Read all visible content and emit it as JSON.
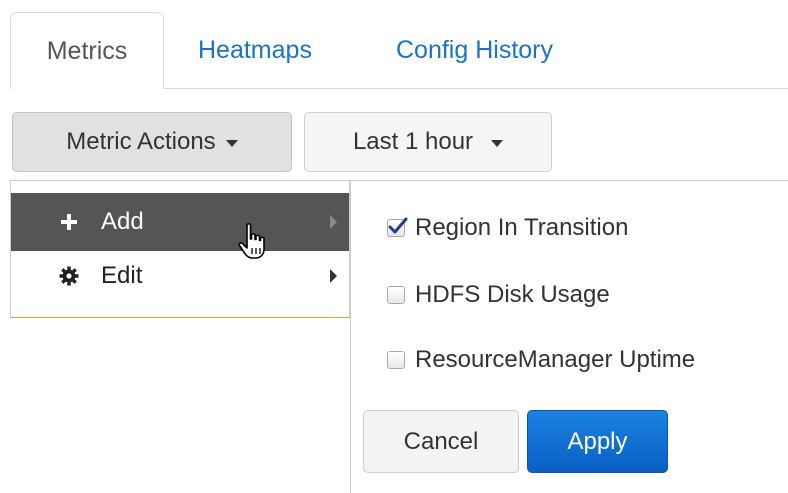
{
  "tabs": [
    {
      "label": "Metrics",
      "active": true
    },
    {
      "label": "Heatmaps",
      "active": false
    },
    {
      "label": "Config History",
      "active": false
    }
  ],
  "toolbar": {
    "metric_actions_label": "Metric Actions",
    "time_range_label": "Last 1 hour"
  },
  "menu": {
    "items": [
      {
        "label": "Add",
        "icon": "plus-icon",
        "highlighted": true,
        "has_submenu": true
      },
      {
        "label": "Edit",
        "icon": "gear-icon",
        "highlighted": false,
        "has_submenu": true
      }
    ]
  },
  "submenu": {
    "options": [
      {
        "label": "Region In Transition",
        "checked": true
      },
      {
        "label": "HDFS Disk Usage",
        "checked": false
      },
      {
        "label": "ResourceManager Uptime",
        "checked": false
      }
    ],
    "cancel_label": "Cancel",
    "apply_label": "Apply"
  },
  "colors": {
    "link": "#1a73c7",
    "menu_highlight": "#555555",
    "apply_button": "#0a6fd6"
  }
}
